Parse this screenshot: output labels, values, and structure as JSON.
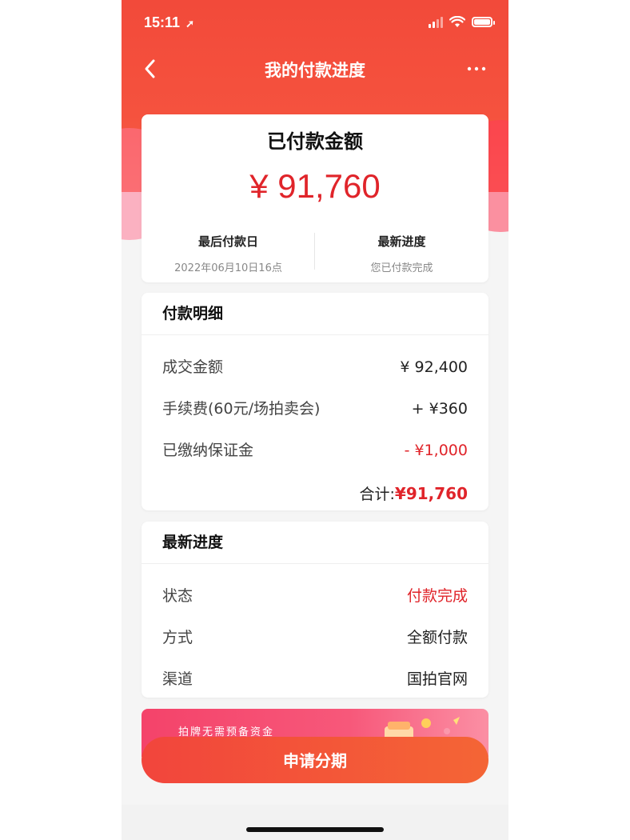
{
  "status_bar": {
    "time": "15:11"
  },
  "nav": {
    "title": "我的付款进度"
  },
  "summary": {
    "title": "已付款金额",
    "amount": "¥ 91,760",
    "last_pay_label": "最后付款日",
    "last_pay_value": "2022年06月10日16点",
    "progress_label": "最新进度",
    "progress_value": "您已付款完成"
  },
  "detail": {
    "title": "付款明细",
    "rows": [
      {
        "label": "成交金额",
        "value": "¥ 92,400"
      },
      {
        "label": "手续费(60元/场拍卖会)",
        "value": "+ ¥360"
      },
      {
        "label": "已缴纳保证金",
        "value": "- ¥1,000"
      }
    ],
    "total_label": "合计:",
    "total_value": "¥91,760"
  },
  "progress": {
    "title": "最新进度",
    "rows": [
      {
        "label": "状态",
        "value": "付款完成"
      },
      {
        "label": "方式",
        "value": "全额付款"
      },
      {
        "label": "渠道",
        "value": "国拍官网"
      }
    ]
  },
  "banner": {
    "text": "拍牌无需预备资金"
  },
  "cta": {
    "label": "申请分期"
  },
  "colors": {
    "brand_red": "#f24a3a",
    "accent_red": "#e0242a"
  }
}
